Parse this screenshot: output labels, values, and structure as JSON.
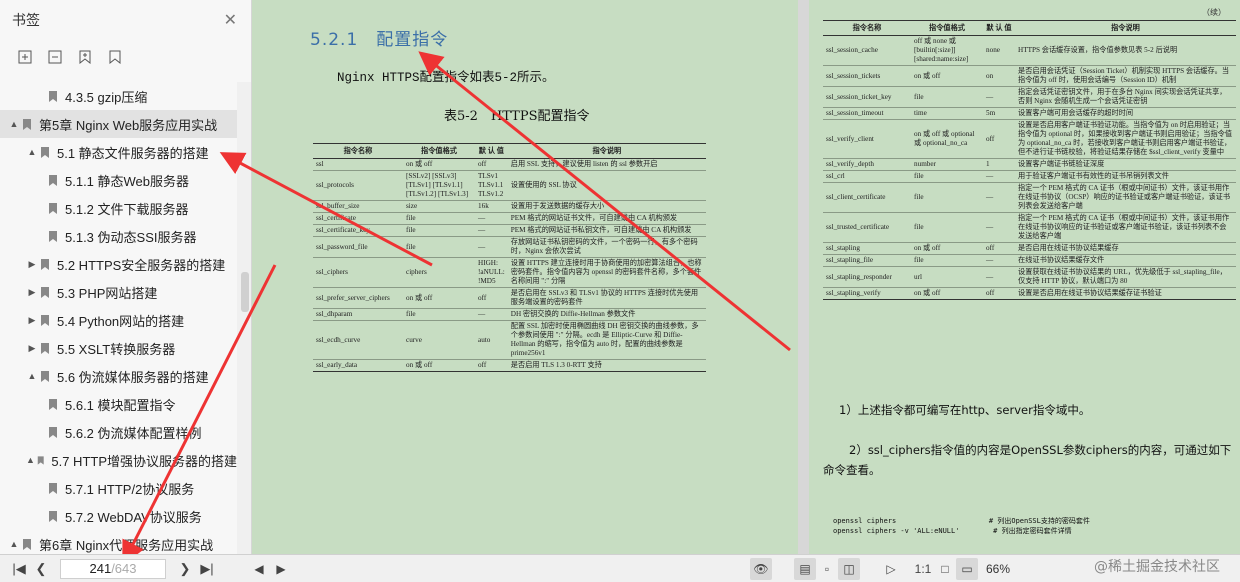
{
  "sidebar": {
    "title": "书签",
    "close_icon": "close-icon",
    "tools": [
      "expand-all-icon",
      "collapse-all-icon",
      "add-bookmark-icon",
      "bookmark-icon"
    ],
    "items": [
      {
        "label": "4.3.5 gzip压缩",
        "level": 3,
        "arrow": ""
      },
      {
        "label": "第5章 Nginx Web服务应用实战",
        "level": 0,
        "arrow": "▲"
      },
      {
        "label": "5.1 静态文件服务器的搭建",
        "level": 1,
        "arrow": "▲"
      },
      {
        "label": "5.1.1 静态Web服务器",
        "level": 2,
        "arrow": ""
      },
      {
        "label": "5.1.2 文件下载服务器",
        "level": 2,
        "arrow": ""
      },
      {
        "label": "5.1.3 伪动态SSI服务器",
        "level": 2,
        "arrow": ""
      },
      {
        "label": "5.2 HTTPS安全服务器的搭建",
        "level": 1,
        "arrow": "▶"
      },
      {
        "label": "5.3 PHP网站搭建",
        "level": 1,
        "arrow": "▶"
      },
      {
        "label": "5.4 Python网站的搭建",
        "level": 1,
        "arrow": "▶"
      },
      {
        "label": "5.5 XSLT转换服务器",
        "level": 1,
        "arrow": "▶"
      },
      {
        "label": "5.6 伪流媒体服务器的搭建",
        "level": 1,
        "arrow": "▲"
      },
      {
        "label": "5.6.1 模块配置指令",
        "level": 2,
        "arrow": ""
      },
      {
        "label": "5.6.2 伪流媒体配置样例",
        "level": 2,
        "arrow": ""
      },
      {
        "label": "5.7 HTTP增强协议服务器的搭建",
        "level": 1,
        "arrow": "▲"
      },
      {
        "label": "5.7.1 HTTP/2协议服务",
        "level": 2,
        "arrow": ""
      },
      {
        "label": "5.7.2 WebDAV协议服务",
        "level": 2,
        "arrow": ""
      },
      {
        "label": "第6章 Nginx代理服务应用实战",
        "level": 0,
        "arrow": "▲"
      }
    ]
  },
  "left_page": {
    "section_title": "5.2.1　配置指令",
    "intro": "Nginx HTTPS配置指令如表5-2所示。",
    "caption": "表5-2　HTTPS配置指令",
    "headers": [
      "指令名称",
      "指令值格式",
      "默 认 值",
      "指令说明"
    ],
    "rows": [
      [
        "ssl",
        "on 或 off",
        "off",
        "启用 SSL 支持，建议使用 listen 的 ssl 参数开启"
      ],
      [
        "ssl_protocols",
        "[SSLv2] [SSLv3] [TLSv1] [TLSv1.1] [TLSv1.2] [TLSv1.3]",
        "TLSv1 TLSv1.1 TLSv1.2",
        "设置使用的 SSL 协议"
      ],
      [
        "ssl_buffer_size",
        "size",
        "16k",
        "设置用于发送数据的缓存大小"
      ],
      [
        "ssl_certificate",
        "file",
        "—",
        "PEM 格式的网站证书文件，可自建或由 CA 机构颁发"
      ],
      [
        "ssl_certificate_key",
        "file",
        "—",
        "PEM 格式的网站证书私钥文件，可自建或由 CA 机构颁发"
      ],
      [
        "ssl_password_file",
        "file",
        "—",
        "存放网站证书私钥密码的文件，一个密码一行，有多个密码时，Nginx 会依次尝试"
      ],
      [
        "ssl_ciphers",
        "ciphers",
        "HIGH: !aNULL: !MD5",
        "设置 HTTPS 建立连接时用于协商使用的加密算法组合，也称密码套件。指令值内容为 openssl 的密码套件名称，多个套件名称间用 \":\" 分隔"
      ],
      [
        "ssl_prefer_server_ciphers",
        "on 或 off",
        "off",
        "是否启用在 SSLv3 和 TLSv1 协议的 HTTPS 连接时优先使用服务端设置的密码套件"
      ],
      [
        "ssl_dhparam",
        "file",
        "—",
        "DH 密钥交换的 Diffie-Hellman 参数文件"
      ],
      [
        "ssl_ecdh_curve",
        "curve",
        "auto",
        "配置 SSL 加密时使用椭圆曲线 DH 密钥交换的曲线参数，多个参数间使用 \":\" 分隔。ecdh 是 Elliptic-Curve 和 Diffie-Hellman 的缩写，指令值为 auto 时，配置的曲线参数是 prime256v1"
      ],
      [
        "ssl_early_data",
        "on 或 off",
        "off",
        "是否启用 TLS 1.3 0-RTT 支持"
      ]
    ]
  },
  "right_page": {
    "continued": "（续）",
    "headers": [
      "指令名称",
      "指令值格式",
      "默 认 值",
      "指令说明"
    ],
    "rows": [
      [
        "ssl_session_cache",
        "off 或 none 或 [builtin[:size]] [shared:name:size]",
        "none",
        "HTTPS 会话缓存设置，指令值参数见表 5-2 后说明"
      ],
      [
        "ssl_session_tickets",
        "on 或 off",
        "on",
        "是否启用会话凭证（Session Ticket）机制实现 HTTPS 会话缓存。当指令值为 off 时，使用会话编号（Session ID）机制"
      ],
      [
        "ssl_session_ticket_key",
        "file",
        "—",
        "指定会话凭证密钥文件，用于在多台 Nginx 间实现会话凭证共享，否则 Nginx 会随机生成一个会话凭证密钥"
      ],
      [
        "ssl_session_timeout",
        "time",
        "5m",
        "设置客户端可用会话缓存的超时时间"
      ],
      [
        "ssl_verify_client",
        "on 或 off 或 optional 或 optional_no_ca",
        "off",
        "设置是否启用客户端证书验证功能。当指令值为 on 时启用验证；当指令值为 optional 时，如果接收到客户端证书则启用验证；当指令值为 optional_no_ca 时，若接收到客户端证书则启用客户端证书验证，但不进行证书链校验，将验证结果存储在 $ssl_client_verify 变量中"
      ],
      [
        "ssl_verify_depth",
        "number",
        "1",
        "设置客户端证书链验证深度"
      ],
      [
        "ssl_crl",
        "file",
        "—",
        "用于验证客户端证书有效性的证书吊销列表文件"
      ],
      [
        "ssl_client_certificate",
        "file",
        "—",
        "指定一个 PEM 格式的 CA 证书（根或中间证书）文件，该证书用作在线证书协议（OCSP）响应的证书验证或客户端证书验证，该证书列表会发送给客户端"
      ],
      [
        "ssl_trusted_certificate",
        "file",
        "—",
        "指定一个 PEM 格式的 CA 证书（根或中间证书）文件，该证书用作在线证书协议响应的证书验证或客户端证书验证，该证书列表不会发送给客户端"
      ],
      [
        "ssl_stapling",
        "on 或 off",
        "off",
        "是否启用在线证书协议结果缓存"
      ],
      [
        "ssl_stapling_file",
        "file",
        "—",
        "在线证书协议结果缓存文件"
      ],
      [
        "ssl_stapling_responder",
        "url",
        "—",
        "设置获取在线证书协议结果的 URL，优先级低于 ssl_stapling_file，仅支持 HTTP 协议，默认端口为 80"
      ],
      [
        "ssl_stapling_verify",
        "on 或 off",
        "off",
        "设置是否启用在线证书协议结果缓存证书验证"
      ]
    ],
    "note1": "1）上述指令都可编写在http、server指令域中。",
    "note2": "2）ssl_ciphers指令值的内容是OpenSSL参数ciphers的内容，可通过如下命令查看。",
    "code": "openssl ciphers                      # 列出OpenSSL支持的密码套件\nopenssl ciphers -v 'ALL:eNULL'        # 列出指定密码套件详情"
  },
  "bottombar": {
    "current_page": "241",
    "total_pages": "/643",
    "zoom": "66%",
    "watermark": "@稀土掘金技术社区"
  },
  "annotation_color": "#ee3333"
}
